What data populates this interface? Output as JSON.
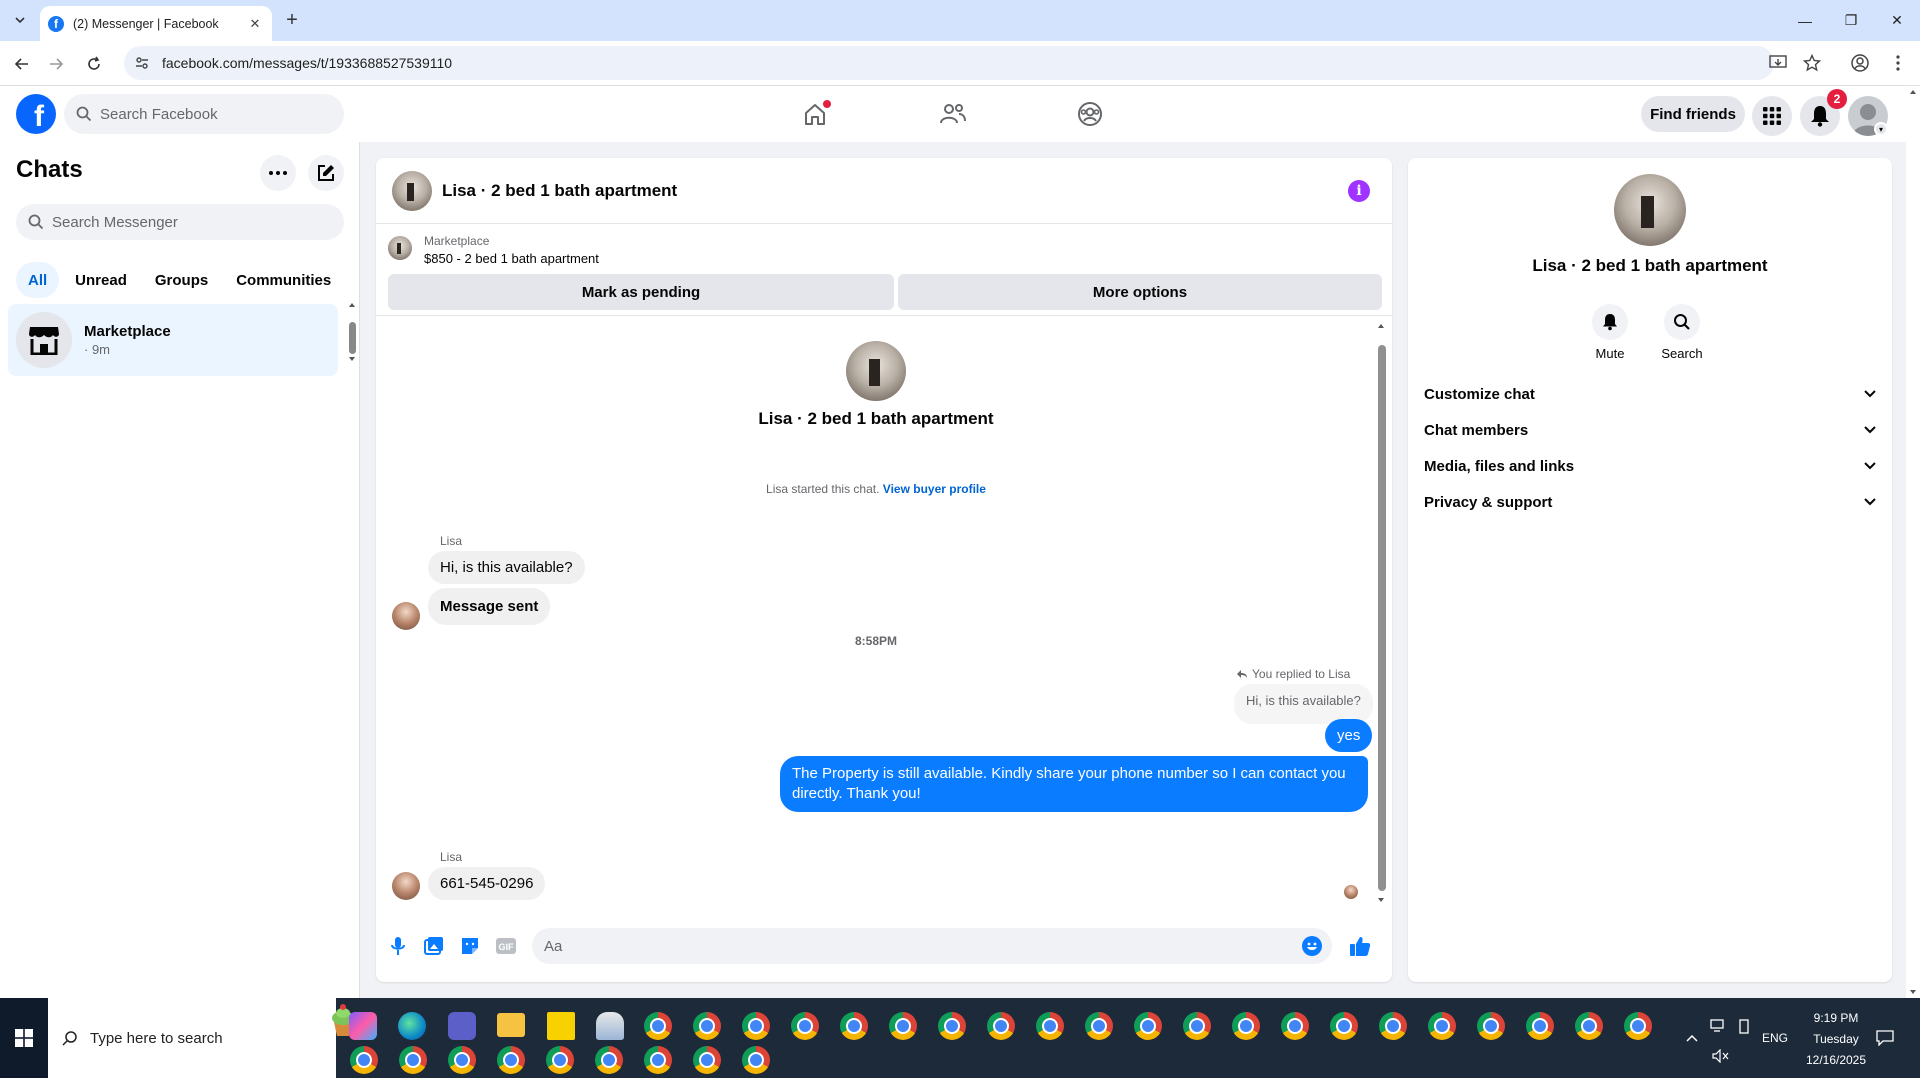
{
  "browser": {
    "tab_title": "(2) Messenger | Facebook",
    "url": "facebook.com/messages/t/1933688527539110"
  },
  "fb": {
    "search_placeholder": "Search Facebook",
    "find_friends": "Find friends",
    "notification_count": "2"
  },
  "sidebar": {
    "title": "Chats",
    "search_placeholder": "Search Messenger",
    "filters": [
      "All",
      "Unread",
      "Groups",
      "Communities"
    ],
    "chat": {
      "name": "Marketplace",
      "time": "· 9m"
    }
  },
  "conversation": {
    "title": "Lisa · 2 bed 1 bath apartment",
    "marketplace_label": "Marketplace",
    "listing": "$850 - 2 bed 1 bath apartment",
    "mark_pending": "Mark as pending",
    "more_options": "More options",
    "intro_name": "Lisa · 2 bed 1 bath apartment",
    "started_text": "Lisa started this chat.",
    "view_buyer": "View buyer profile",
    "sender1": "Lisa",
    "msg1": "Hi, is this available?",
    "msg2": "Message sent",
    "time1": "8:58PM",
    "replied_label": "You replied to Lisa",
    "quoted": "Hi, is this available?",
    "my_msg1": "yes",
    "my_msg2_line1": "The Property is still available. Kindly share your phone number so I can contact you",
    "my_msg2_line2": "directly. Thank you!",
    "sender2": "Lisa",
    "msg3": "661-545-0296",
    "composer_placeholder": "Aa"
  },
  "right_panel": {
    "name": "Lisa · 2 bed 1 bath apartment",
    "mute": "Mute",
    "search": "Search",
    "sections": [
      "Customize chat",
      "Chat members",
      "Media, files and links",
      "Privacy & support"
    ]
  },
  "taskbar": {
    "search_placeholder": "Type here to search",
    "language": "ENG",
    "time": "9:19 PM",
    "day": "Tuesday",
    "date": "12/16/2025"
  },
  "colors": {
    "fb_blue": "#0866ff",
    "message_blue": "#0a7cff",
    "info_purple": "#a033ff",
    "badge_red": "#e41e3f"
  }
}
